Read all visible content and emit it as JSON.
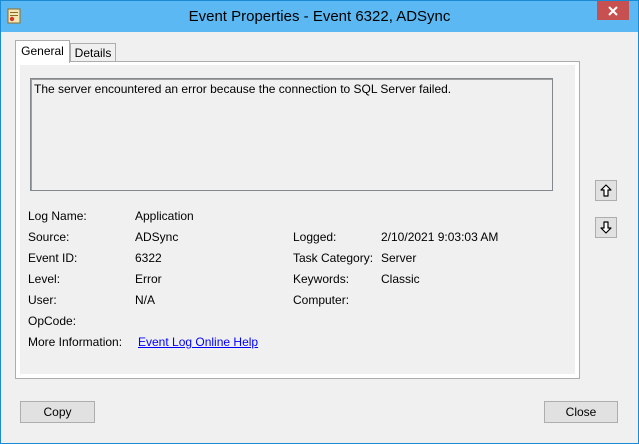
{
  "window": {
    "title": "Event Properties - Event 6322, ADSync"
  },
  "tabs": [
    {
      "label": "General",
      "active": true
    },
    {
      "label": "Details",
      "active": false
    }
  ],
  "description": "The server encountered an error because the connection to SQL Server failed.",
  "fields": {
    "log_name": {
      "label": "Log Name:",
      "value": "Application"
    },
    "source": {
      "label": "Source:",
      "value": "ADSync"
    },
    "event_id": {
      "label": "Event ID:",
      "value": "6322"
    },
    "level": {
      "label": "Level:",
      "value": "Error"
    },
    "user": {
      "label": "User:",
      "value": "N/A"
    },
    "opcode": {
      "label": "OpCode:",
      "value": ""
    },
    "more_info": {
      "label": "More Information:",
      "link": "Event Log Online Help"
    },
    "logged": {
      "label": "Logged:",
      "value": "2/10/2021 9:03:03 AM"
    },
    "task_category": {
      "label": "Task Category:",
      "value": "Server"
    },
    "keywords": {
      "label": "Keywords:",
      "value": "Classic"
    },
    "computer": {
      "label": "Computer:",
      "value": ""
    }
  },
  "buttons": {
    "copy": "Copy",
    "close": "Close"
  },
  "icons": {
    "app": "event-viewer-icon",
    "close": "close-icon",
    "up": "arrow-up-icon",
    "down": "arrow-down-icon"
  },
  "colors": {
    "titlebar": "#5cb8f2",
    "close_button": "#c75050",
    "link": "#0000ff"
  }
}
